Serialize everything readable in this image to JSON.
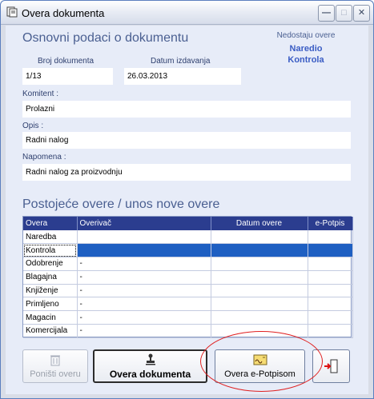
{
  "window": {
    "title": "Overa dokumenta"
  },
  "header": {
    "section_title": "Osnovni podaci o dokumentu",
    "missing_label": "Nedostaju overe",
    "missing_items": [
      "Naredio",
      "Kontrola"
    ]
  },
  "form": {
    "doc_number_label": "Broj dokumenta",
    "doc_number_value": "1/13",
    "issue_date_label": "Datum izdavanja",
    "issue_date_value": "26.03.2013",
    "client_label": "Komitent :",
    "client_value": "Prolazni",
    "description_label": "Opis :",
    "description_value": "Radni nalog",
    "note_label": "Napomena :",
    "note_value": "Radni nalog za proizvodnju"
  },
  "approvals": {
    "section_title": "Postojeće overe / unos nove overe",
    "columns": [
      "Overa",
      "Overivač",
      "Datum overe",
      "e-Potpis"
    ],
    "rows": [
      {
        "overa": "Naredba",
        "overivac": "",
        "datum": "",
        "epotpis": ""
      },
      {
        "overa": "Kontrola",
        "overivac": "",
        "datum": "",
        "epotpis": ""
      },
      {
        "overa": "Odobrenje",
        "overivac": "-",
        "datum": "",
        "epotpis": ""
      },
      {
        "overa": "Blagajna",
        "overivac": "-",
        "datum": "",
        "epotpis": ""
      },
      {
        "overa": "Knjiženje",
        "overivac": "-",
        "datum": "",
        "epotpis": ""
      },
      {
        "overa": "Primljeno",
        "overivac": "-",
        "datum": "",
        "epotpis": ""
      },
      {
        "overa": "Magacin",
        "overivac": "-",
        "datum": "",
        "epotpis": ""
      },
      {
        "overa": "Komercijala",
        "overivac": "-",
        "datum": "",
        "epotpis": ""
      }
    ],
    "selected_row": 1
  },
  "buttons": {
    "cancel_label": "Poništi overu",
    "approve_label": "Overa dokumenta",
    "esign_label": "Overa e-Potpisom"
  },
  "colors": {
    "accent_text": "#4a5f91",
    "missing_text": "#3a5cc4",
    "grid_header": "#2b3d8f",
    "selection": "#1e5fc2",
    "annotation_ring": "#e02020"
  },
  "icons": {
    "app": "document-icon",
    "cancel": "trash-icon",
    "approve": "stamp-icon",
    "esign": "signature-card-icon",
    "exit": "exit-door-icon"
  }
}
